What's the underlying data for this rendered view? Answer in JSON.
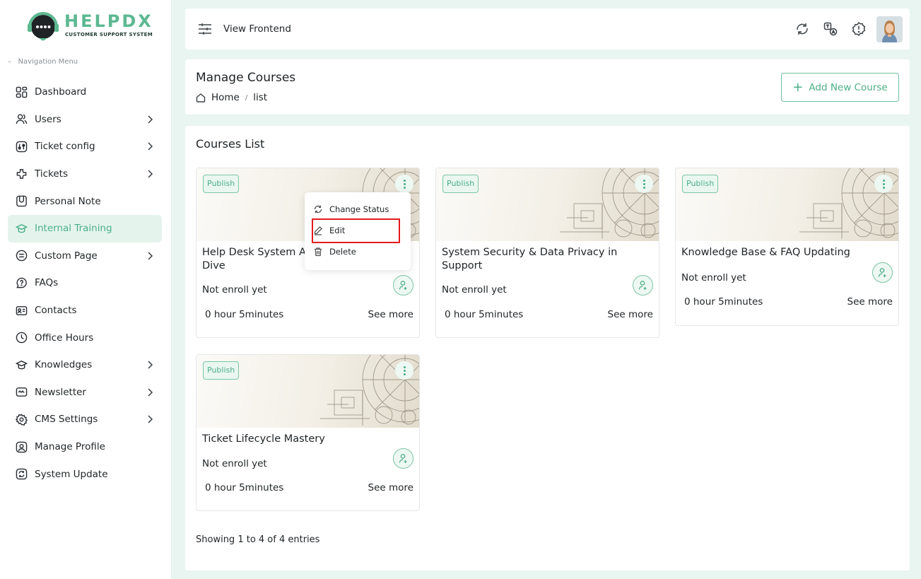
{
  "brand": {
    "name": "HELPDX",
    "tagline": "CUSTOMER SUPPORT SYSTEM",
    "color": "#5cb891"
  },
  "sidebar": {
    "heading": "Navigation Menu",
    "items": [
      {
        "label": "Dashboard",
        "icon": "dashboard-icon"
      },
      {
        "label": "Users",
        "icon": "users-icon",
        "submenu": true
      },
      {
        "label": "Ticket config",
        "icon": "ticket-config-icon",
        "submenu": true
      },
      {
        "label": "Tickets",
        "icon": "tickets-icon",
        "submenu": true
      },
      {
        "label": "Personal Note",
        "icon": "note-icon"
      },
      {
        "label": "Internal Training",
        "icon": "training-icon",
        "active": true
      },
      {
        "label": "Custom Page",
        "icon": "custom-page-icon",
        "submenu": true
      },
      {
        "label": "FAQs",
        "icon": "faq-icon"
      },
      {
        "label": "Contacts",
        "icon": "contacts-icon"
      },
      {
        "label": "Office Hours",
        "icon": "clock-icon"
      },
      {
        "label": "Knowledges",
        "icon": "knowledge-icon",
        "submenu": true
      },
      {
        "label": "Newsletter",
        "icon": "newsletter-icon",
        "submenu": true
      },
      {
        "label": "CMS Settings",
        "icon": "gear-icon",
        "submenu": true
      },
      {
        "label": "Manage Profile",
        "icon": "profile-icon"
      },
      {
        "label": "System Update",
        "icon": "refresh-icon"
      }
    ]
  },
  "header": {
    "view_frontend": "View Frontend",
    "icons": [
      "sync-icon",
      "translate-icon",
      "alert-icon"
    ]
  },
  "page": {
    "title": "Manage Courses",
    "breadcrumb": [
      "Home",
      "list"
    ],
    "add_button": "Add New Course"
  },
  "courses_section": {
    "title": "Courses List",
    "entries_text": "Showing 1 to 4 of 4 entries"
  },
  "courses": [
    {
      "status": "Publish",
      "title": "Help Desk System A                         Dive",
      "enroll": "Not enroll yet",
      "duration": "0 hour 5minutes",
      "see_more": "See more"
    },
    {
      "status": "Publish",
      "title": "System Security & Data Privacy in Support",
      "enroll": "Not enroll yet",
      "duration": "0 hour 5minutes",
      "see_more": "See more"
    },
    {
      "status": "Publish",
      "title": "Knowledge Base & FAQ Updating",
      "enroll": "Not enroll yet",
      "duration": "0 hour 5minutes",
      "see_more": "See more"
    },
    {
      "status": "Publish",
      "title": "Ticket Lifecycle Mastery",
      "enroll": "Not enroll yet",
      "duration": "0 hour 5minutes",
      "see_more": "See more"
    }
  ],
  "dropdown": {
    "items": [
      "Change Status",
      "Edit",
      "Delete"
    ],
    "highlighted": "Edit"
  }
}
